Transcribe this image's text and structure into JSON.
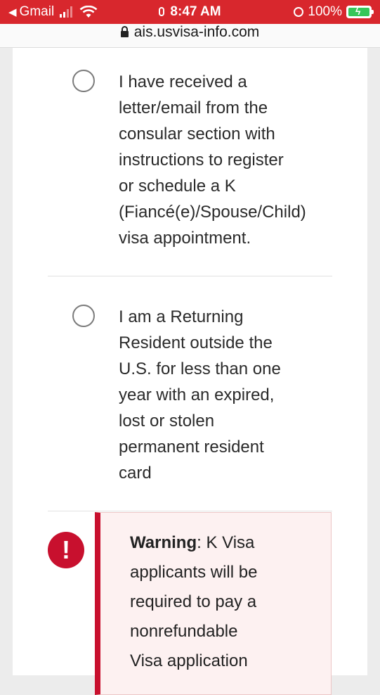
{
  "status_bar": {
    "back_app": "Gmail",
    "time": "8:47 AM",
    "battery": "100%"
  },
  "url_bar": {
    "url": "ais.usvisa-info.com"
  },
  "options": [
    {
      "label_lines": [
        "I have received a",
        "letter/email from the",
        "consular section with",
        "instructions to register",
        "or schedule a K",
        "(Fiancé(e)/Spouse/Child)",
        "visa appointment."
      ],
      "selected": false
    },
    {
      "label_lines": [
        "I am a Returning",
        "Resident outside the",
        "U.S. for less than one",
        "year with an expired,",
        "lost or stolen",
        "permanent resident",
        "card"
      ],
      "selected": false
    }
  ],
  "warning": {
    "title": "Warning",
    "lines": [
      ": K Visa",
      "applicants will be",
      "required to pay a",
      "nonrefundable",
      "Visa application"
    ]
  },
  "colors": {
    "status_bar": "#d8272d",
    "warning_accent": "#c8102e",
    "warning_bg": "#fdf1f1"
  }
}
